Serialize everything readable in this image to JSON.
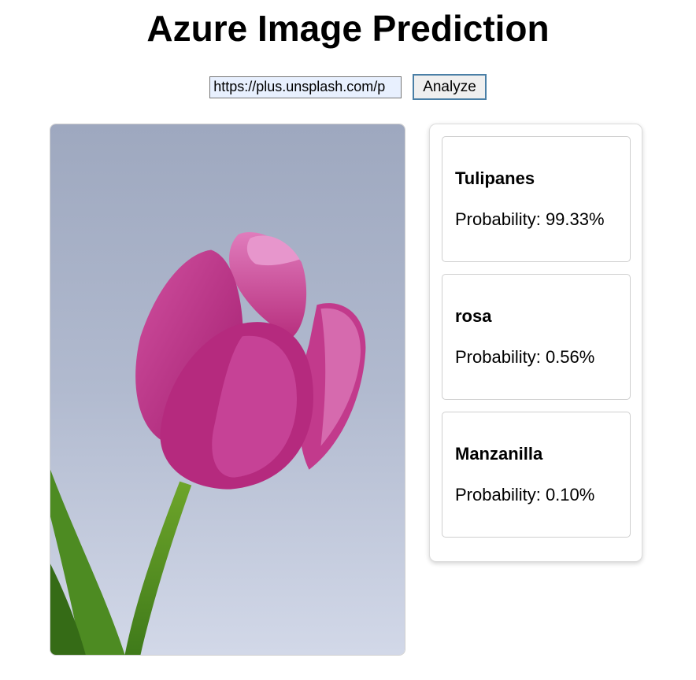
{
  "page": {
    "title": "Azure Image Prediction"
  },
  "controls": {
    "url_value": "https://plus.unsplash.com/p",
    "analyze_label": "Analyze"
  },
  "image": {
    "alt": "Pink tulip against a pale blue background"
  },
  "predictions": [
    {
      "tag": "Tulipanes",
      "probability_text": "Probability: 99.33%",
      "probability": 99.33
    },
    {
      "tag": "rosa",
      "probability_text": "Probability: 0.56%",
      "probability": 0.56
    },
    {
      "tag": "Manzanilla",
      "probability_text": "Probability: 0.10%",
      "probability": 0.1
    }
  ]
}
